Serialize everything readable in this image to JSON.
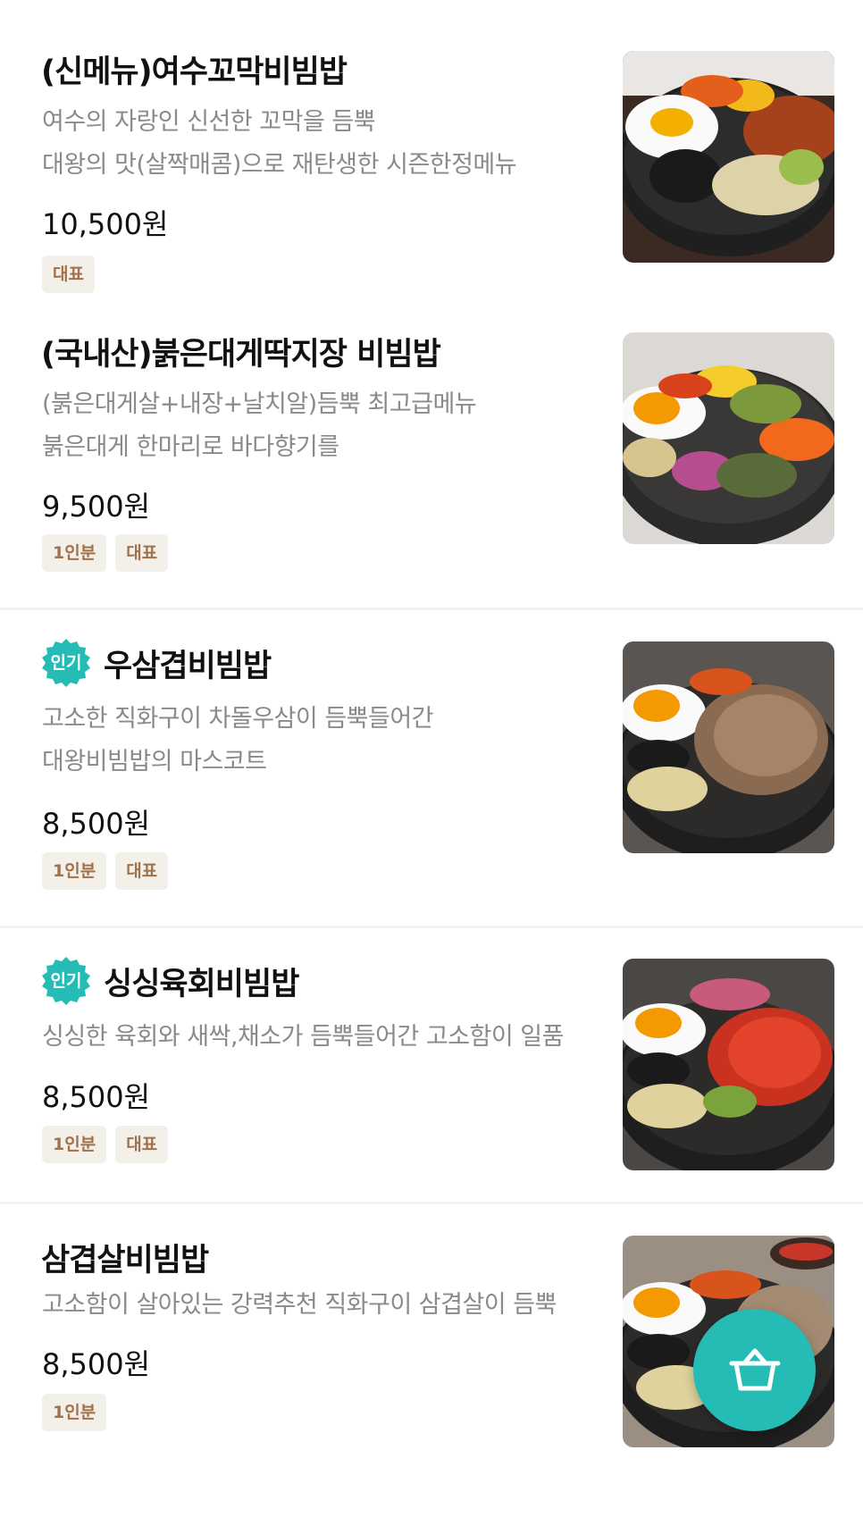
{
  "menu": {
    "items": [
      {
        "title": "(신메뉴)여수꼬막비빔밥",
        "desc": [
          "여수의 자랑인 신선한 꼬막을 듬뿍",
          "대왕의 맛(살짝매콤)으로 재탄생한 시즌한정메뉴"
        ],
        "price": "10,500원",
        "tags": [
          "대표"
        ]
      },
      {
        "title": "(국내산)붉은대게딱지장 비빔밥",
        "desc": [
          "(붉은대게살+내장+날치알)듬뿍 최고급메뉴",
          "붉은대게 한마리로 바다향기를"
        ],
        "price": "9,500원",
        "tags": [
          "1인분",
          "대표"
        ]
      },
      {
        "badge": "인기",
        "title": "우삼겹비빔밥",
        "desc": [
          "고소한 직화구이 차돌우삼이 듬뿍들어간",
          "대왕비빔밥의 마스코트"
        ],
        "price": "8,500원",
        "tags": [
          "1인분",
          "대표"
        ]
      },
      {
        "badge": "인기",
        "title": "싱싱육회비빔밥",
        "desc": [
          "싱싱한 육회와 새싹,채소가 듬뿍들어간 고소함이 일품"
        ],
        "price": "8,500원",
        "tags": [
          "1인분",
          "대표"
        ]
      },
      {
        "title": "삼겹살비빔밥",
        "desc": [
          "고소함이 살아있는 강력추천 직화구이 삼겹살이 듬뿍"
        ],
        "price": "8,500원",
        "tags": [
          "1인분"
        ]
      }
    ]
  },
  "cart": {
    "icon": "shopping-basket-icon"
  },
  "colors": {
    "accent": "#26bcb6",
    "tag_bg": "#f3efe9",
    "tag_text": "#a0714a",
    "desc": "#8a8a8a"
  }
}
